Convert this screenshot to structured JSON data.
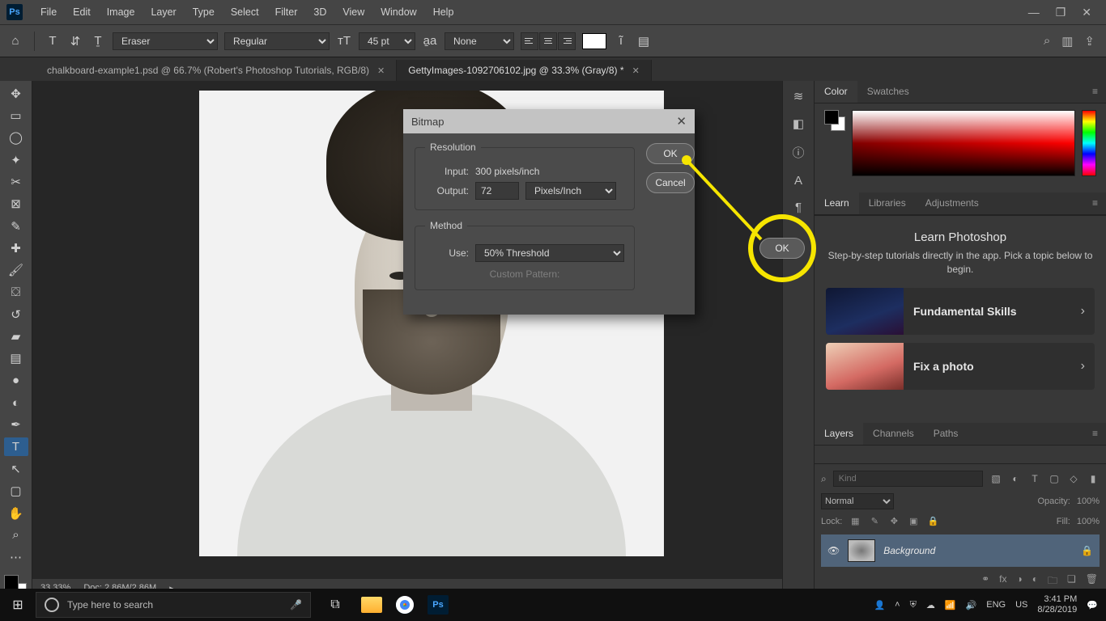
{
  "menu": {
    "items": [
      "File",
      "Edit",
      "Image",
      "Layer",
      "Type",
      "Select",
      "Filter",
      "3D",
      "View",
      "Window",
      "Help"
    ]
  },
  "options": {
    "tool_preset": "Eraser",
    "font_style": "Regular",
    "font_size": "45 pt",
    "anti_alias": "None"
  },
  "tabs": [
    {
      "label": "chalkboard-example1.psd @ 66.7% (Robert's Photoshop Tutorials, RGB/8)",
      "active": false
    },
    {
      "label": "GettyImages-1092706102.jpg @ 33.3% (Gray/8) *",
      "active": true
    }
  ],
  "canvas_status": {
    "zoom": "33.33%",
    "doc": "Doc: 2.86M/2.86M"
  },
  "panels": {
    "color_tabs": [
      "Color",
      "Swatches"
    ],
    "learn_tabs": [
      "Learn",
      "Libraries",
      "Adjustments"
    ],
    "learn": {
      "title": "Learn Photoshop",
      "subtitle": "Step-by-step tutorials directly in the app. Pick a topic below to begin.",
      "lessons": [
        "Fundamental Skills",
        "Fix a photo"
      ]
    },
    "layers_tabs": [
      "Layers",
      "Channels",
      "Paths"
    ],
    "layers": {
      "filter_placeholder": "Kind",
      "blend": "Normal",
      "opacity_label": "Opacity:",
      "opacity": "100%",
      "lock_label": "Lock:",
      "fill_label": "Fill:",
      "fill": "100%",
      "item_name": "Background"
    }
  },
  "dialog": {
    "title": "Bitmap",
    "resolution_legend": "Resolution",
    "input_label": "Input:",
    "input_value": "300 pixels/inch",
    "output_label": "Output:",
    "output_value": "72",
    "output_unit": "Pixels/Inch",
    "method_legend": "Method",
    "use_label": "Use:",
    "use_value": "50% Threshold",
    "custom_pattern": "Custom Pattern:",
    "ok": "OK",
    "cancel": "Cancel"
  },
  "annotation": {
    "ok": "OK"
  },
  "taskbar": {
    "search_placeholder": "Type here to search",
    "lang": "ENG",
    "locale": "US",
    "time": "3:41 PM",
    "date": "8/28/2019"
  }
}
